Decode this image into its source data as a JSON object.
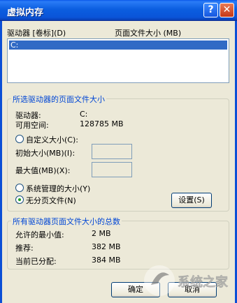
{
  "window": {
    "title": "虚拟内存",
    "help_glyph": "?",
    "close_glyph": "✕"
  },
  "columns": {
    "drive": "驱动器 [卷标](D)",
    "paging_size": "页面文件大小 (MB)"
  },
  "drives": [
    {
      "name": "C:",
      "selected": true
    }
  ],
  "selected_group": {
    "title": "所选驱动器的页面文件大小",
    "drive_label": "驱动器:",
    "drive_value": "C:",
    "free_label": "可用空间:",
    "free_value": "128785 MB",
    "custom_label": "自定义大小(C):",
    "initial_label": "初始大小(MB)(I):",
    "max_label": "最大值(MB)(X):",
    "system_label": "系统管理的大小(Y)",
    "none_label": "无分页文件(N)",
    "set_button": "设置(S)",
    "selected_option": "none"
  },
  "totals_group": {
    "title": "所有驱动器页面文件大小的总数",
    "min_label": "允许的最小值:",
    "min_value": "2 MB",
    "rec_label": "推荐:",
    "rec_value": "382 MB",
    "cur_label": "当前已分配:",
    "cur_value": "384 MB"
  },
  "footer": {
    "ok_label": "确定",
    "cancel_label": "取消"
  },
  "watermark": {
    "text": "系统之家"
  },
  "colors": {
    "title_bar": "#0a58ea",
    "dialog_bg": "#ece9d8",
    "group_title": "#0046d5",
    "selection": "#316ac5"
  }
}
